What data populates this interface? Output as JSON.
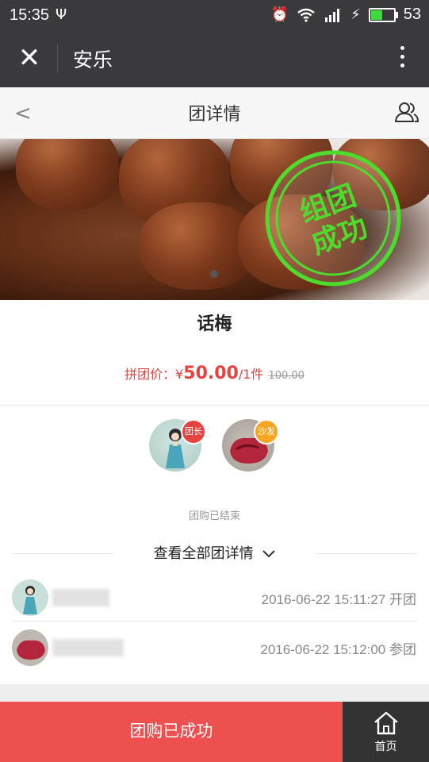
{
  "status_bar": {
    "time": "15:35",
    "battery": "53",
    "battery_level": 0.53
  },
  "app_bar": {
    "title": "安乐"
  },
  "nav": {
    "title": "团详情"
  },
  "banner": {
    "stamp_text_line1": "组团",
    "stamp_text_line2": "成功"
  },
  "product": {
    "name": "话梅",
    "price_label": "拼团价：",
    "currency": "¥",
    "price": "50.00",
    "unit": "/1件",
    "original_price": "100.00"
  },
  "participants": [
    {
      "badge": "团长",
      "badge_color": "#e64340"
    },
    {
      "badge": "沙发",
      "badge_color": "#f5a623"
    }
  ],
  "status_text": "团购已结束",
  "view_all": "查看全部团详情",
  "members": [
    {
      "time": "2016-06-22 15:11:27",
      "action": "开团"
    },
    {
      "time": "2016-06-22 15:12:00",
      "action": "参团"
    }
  ],
  "bottom": {
    "button": "团购已成功",
    "home": "首页"
  },
  "colors": {
    "accent": "#e64340",
    "stamp": "#4ddc2b",
    "bottom_button": "#ee4f4f"
  }
}
